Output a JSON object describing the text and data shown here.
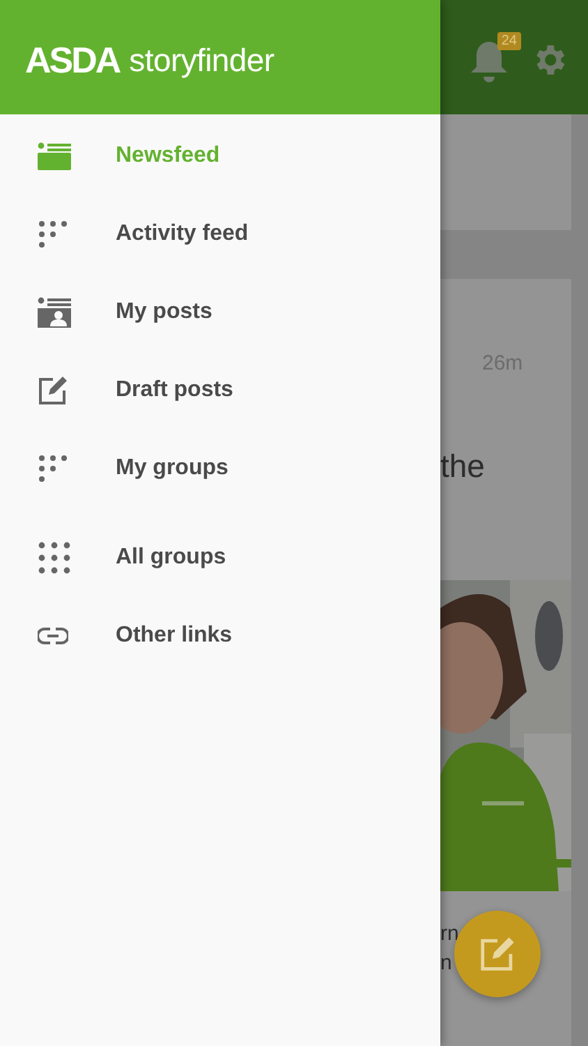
{
  "drawer": {
    "brand": "ASDA",
    "product": "storyfinder",
    "items": [
      {
        "label": "Newsfeed",
        "selected": true
      },
      {
        "label": "Activity feed",
        "selected": false
      },
      {
        "label": "My posts",
        "selected": false
      },
      {
        "label": "Draft posts",
        "selected": false
      },
      {
        "label": "My groups",
        "selected": false
      },
      {
        "label": "All groups",
        "selected": false
      },
      {
        "label": "Other links",
        "selected": false
      }
    ]
  },
  "background": {
    "notification_count": "24",
    "post": {
      "time": "26m",
      "title_fragment": "the",
      "footer_lines": [
        "rn",
        "n"
      ]
    }
  }
}
